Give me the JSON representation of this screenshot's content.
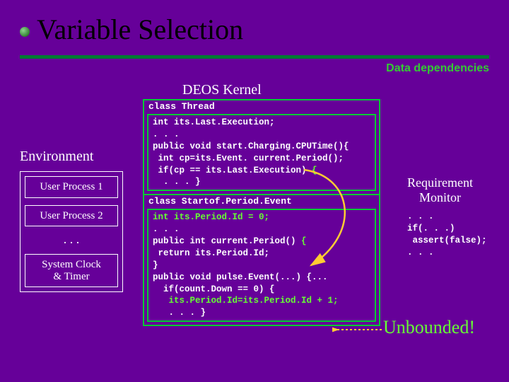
{
  "title": "Variable Selection",
  "subtitle": "Data dependencies",
  "kernel_label": "DEOS Kernel",
  "env": {
    "label": "Environment",
    "boxes": [
      "User Process 1",
      "User Process 2"
    ],
    "dots": ". . .",
    "clock": "System Clock\n& Timer"
  },
  "code": {
    "thread_header": "class Thread",
    "thread_body_pre": "int its.Last.Execution;\n. . .\npublic void start.Charging.CPUTime(){\n int cp=its.Event. current.Period();\n if(cp == its.Last.Execution) ",
    "thread_body_brace": "{",
    "thread_body_post": "\n  . . . }",
    "spe_header": "class Startof.Period.Event",
    "spe_line1": "int its.Period.Id = 0;",
    "spe_body_mid": ". . .\npublic int current.Period() ",
    "spe_brace": "{",
    "spe_body_mid2": "\n return its.Period.Id;\n}\npublic void pulse.Event(...) {...\n  if(count.Down == 0) {\n   ",
    "spe_hl": "its.Period.Id=its.Period.Id + 1;",
    "spe_body_end": "\n   . . . }"
  },
  "req": {
    "label": "Requirement\nMonitor",
    "code": ". . .\nif(. . .)\n assert(false);\n. . ."
  },
  "unbounded": "Unbounded!"
}
